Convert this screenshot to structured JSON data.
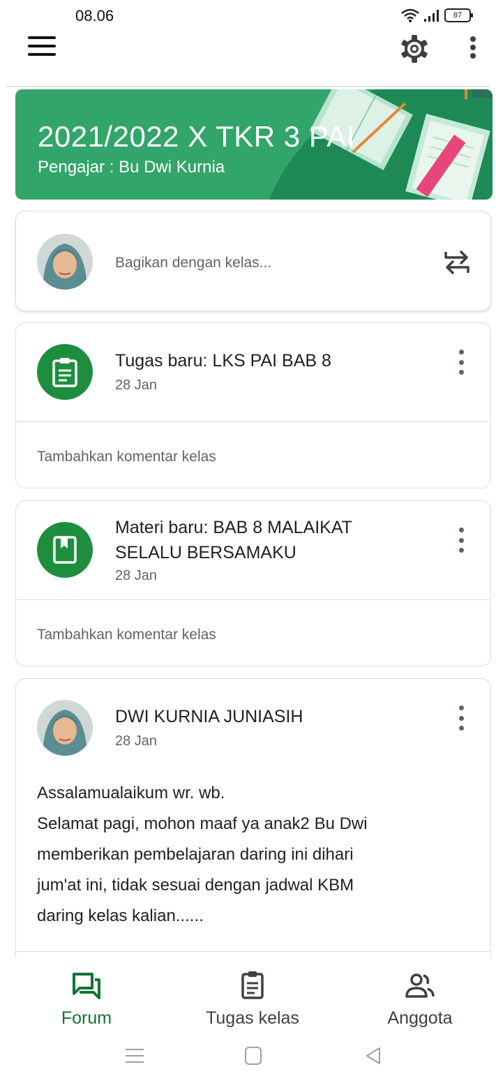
{
  "status_bar": {
    "time": "08.06",
    "battery": "87"
  },
  "banner": {
    "title": "2021/2022 X TKR 3 PAI",
    "subtitle": "Pengajar : Bu Dwi Kurnia",
    "colors": {
      "background": "#32a56a",
      "dark": "#1d8a55"
    }
  },
  "share": {
    "placeholder": "Bagikan dengan kelas..."
  },
  "posts": [
    {
      "icon": "assignment-icon",
      "title": "Tugas baru: LKS PAI BAB 8",
      "date": "28 Jan",
      "comment": "Tambahkan komentar kelas"
    },
    {
      "icon": "material-icon",
      "title_line1": "Materi baru: BAB 8 MALAIKAT",
      "title_line2": "SELALU BERSAMAKU",
      "date": "28 Jan",
      "comment": "Tambahkan komentar kelas"
    }
  ],
  "announcement": {
    "author": "DWI KURNIA JUNIASIH",
    "date": "28 Jan",
    "lines": [
      "Assalamualaikum wr. wb.",
      "Selamat pagi, mohon maaf ya anak2 Bu Dwi",
      "memberikan pembelajaran daring ini dihari",
      "jum'at ini, tidak sesuai dengan jadwal KBM",
      "daring kelas kalian......"
    ]
  },
  "bottom_nav": {
    "items": [
      {
        "label": "Forum",
        "icon": "forum-icon",
        "active": true
      },
      {
        "label": "Tugas kelas",
        "icon": "classwork-icon",
        "active": false
      },
      {
        "label": "Anggota",
        "icon": "people-icon",
        "active": false
      }
    ],
    "active_color": "#137333"
  }
}
